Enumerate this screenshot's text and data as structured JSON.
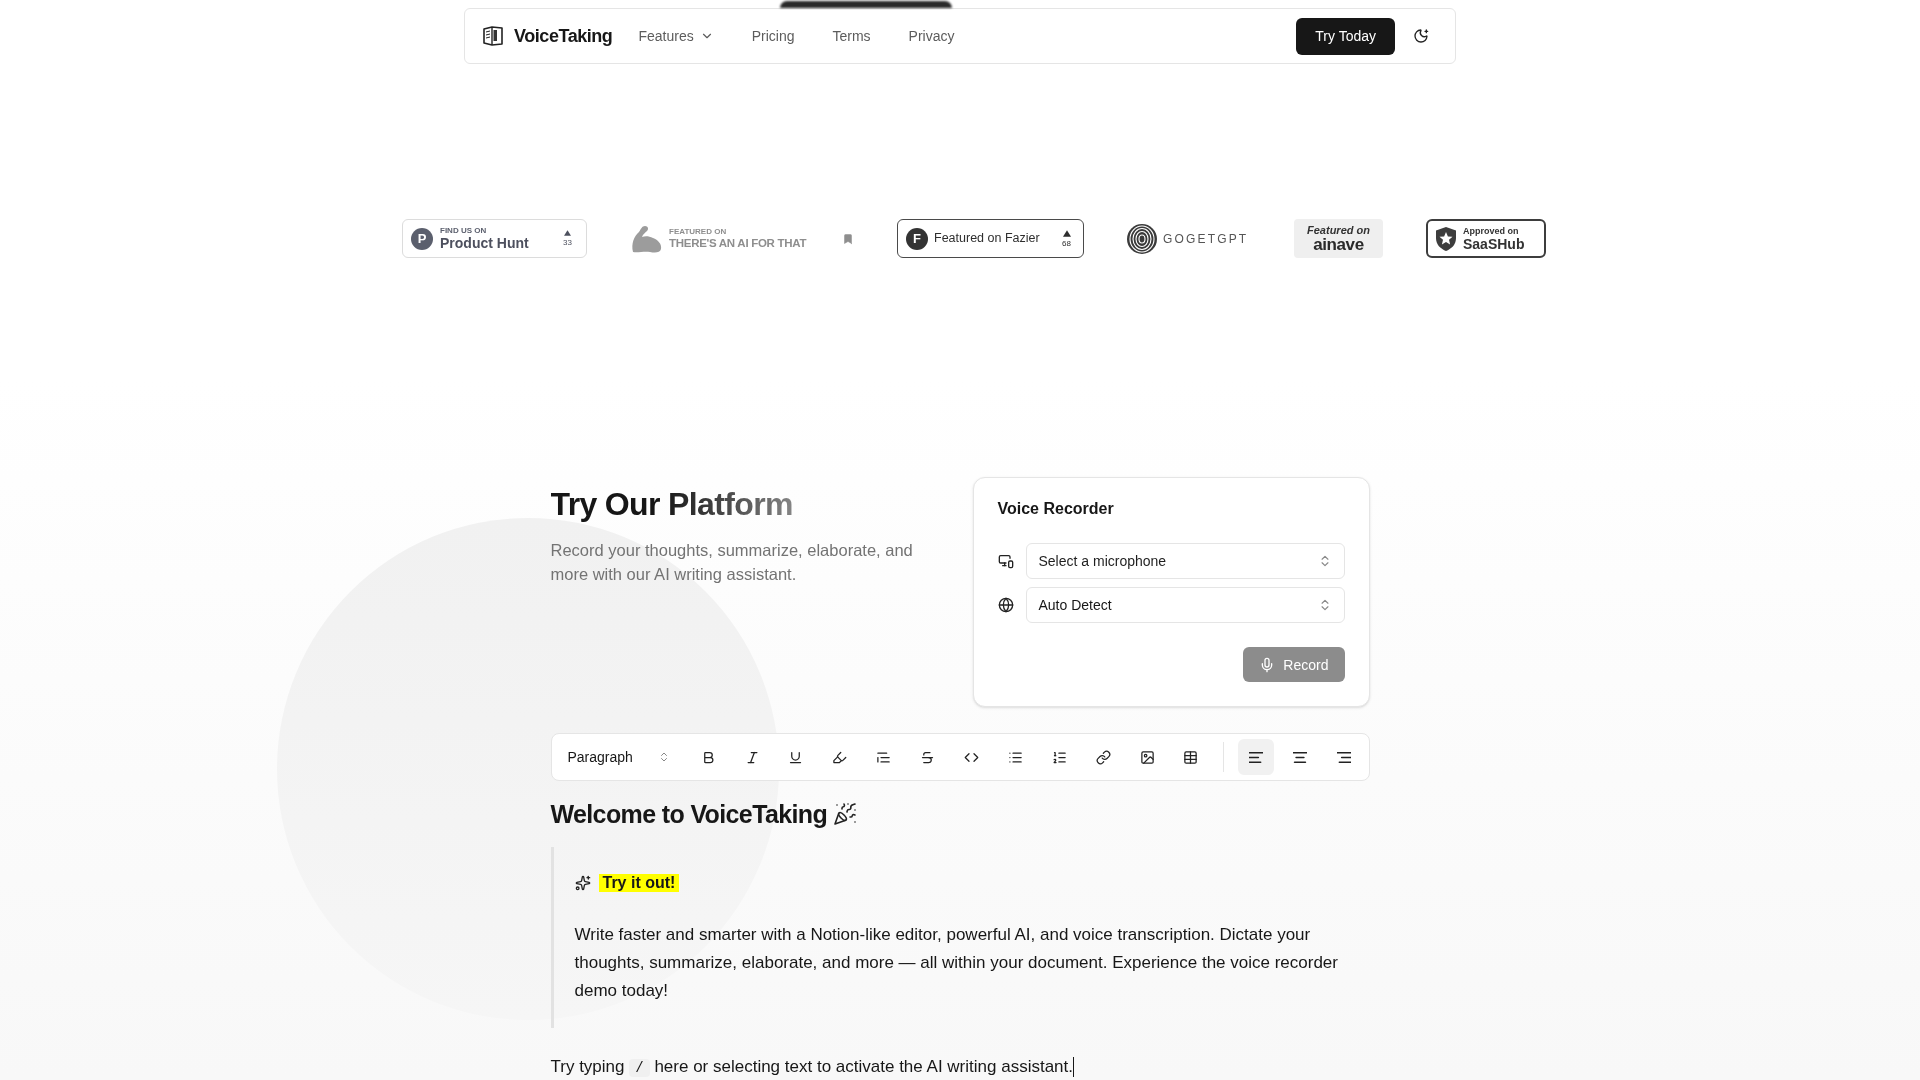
{
  "nav": {
    "brand": "VoiceTaking",
    "links": [
      {
        "label": "Features",
        "kind": "dropdown"
      },
      {
        "label": "Pricing",
        "kind": "link"
      },
      {
        "label": "Terms",
        "kind": "link"
      },
      {
        "label": "Privacy",
        "kind": "link"
      }
    ],
    "cta": "Try Today"
  },
  "badges": [
    {
      "kind": "producthunt",
      "mark": "P",
      "caption": "FIND US ON",
      "name": "Product Hunt",
      "count": "33"
    },
    {
      "kind": "aiforthat",
      "caption": "FEATURED ON",
      "name": "THERE'S AN AI FOR THAT"
    },
    {
      "kind": "fazier",
      "mark": "F",
      "name": "Featured on Fazier",
      "count": "68"
    },
    {
      "kind": "gogetgpt",
      "name": "GOGETGPT"
    },
    {
      "kind": "ainave",
      "caption": "Featured on",
      "name": "ainave"
    },
    {
      "kind": "saashub",
      "caption": "Approved on",
      "name": "SaaSHub"
    }
  ],
  "platform": {
    "title": "Try Our Platform",
    "description": "Record your thoughts, summarize, elaborate, and more with our AI writing assistant."
  },
  "recorder": {
    "title": "Voice Recorder",
    "microphone_select": {
      "placeholder": "Select a microphone"
    },
    "language_select": {
      "value": "Auto Detect"
    },
    "record_button": {
      "label": "Record",
      "disabled": true
    }
  },
  "toolbar": {
    "block_type": "Paragraph",
    "alignment": [
      {
        "selected": true
      },
      {
        "selected": false
      },
      {
        "selected": false
      }
    ]
  },
  "document": {
    "heading": "Welcome to VoiceTaking",
    "callout": {
      "title": "Try it out!",
      "text": "Write faster and smarter with a Notion-like editor, powerful AI, and voice transcription. Dictate your thoughts, summarize, elaborate, and more — all within your document. Experience the voice recorder demo today!"
    },
    "prompt": {
      "before": "Try typing",
      "code": "/",
      "after": "here or selecting text to activate the AI writing assistant."
    }
  }
}
